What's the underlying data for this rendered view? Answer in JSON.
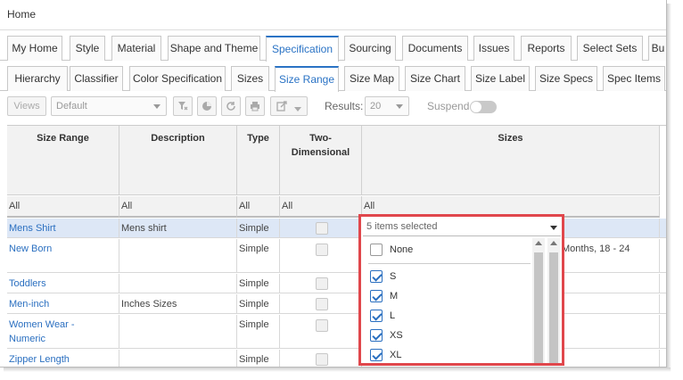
{
  "home": "Home",
  "tabs_main": [
    "My Home",
    "Style",
    "Material",
    "Shape and Theme",
    "Specification",
    "Sourcing",
    "Documents",
    "Issues",
    "Reports",
    "Select Sets",
    "Bu"
  ],
  "tabs_sub": [
    "Hierarchy",
    "Classifier",
    "Color Specification",
    "Sizes",
    "Size Range",
    "Size Map",
    "Size Chart",
    "Size Label",
    "Size Specs",
    "Spec Items"
  ],
  "active_main": "Specification",
  "active_sub": "Size Range",
  "toolbar": {
    "views": "Views",
    "view_select": "Default",
    "results_label": "Results:",
    "results_value": "20",
    "suspend_label": "Suspend"
  },
  "grid": {
    "headers": [
      "Size Range",
      "Description",
      "Type",
      "Two-\nDimensional",
      "Sizes"
    ],
    "filters": [
      "All",
      "All",
      "All",
      "All",
      "All"
    ],
    "rows": [
      {
        "name": "Mens Shirt",
        "desc": "Mens shirt",
        "type": "Simple",
        "sizes": ""
      },
      {
        "name": "New Born",
        "desc": "",
        "type": "Simple",
        "sizes": "Months, 18 - 24"
      },
      {
        "name": "Toddlers",
        "desc": "",
        "type": "Simple",
        "sizes": ""
      },
      {
        "name": "Men-inch",
        "desc": "Inches Sizes",
        "type": "Simple",
        "sizes": ""
      },
      {
        "name": "Women Wear -\nNumeric",
        "desc": "",
        "type": "Simple",
        "sizes": ""
      },
      {
        "name": "Zipper Length",
        "desc": "",
        "type": "Simple",
        "sizes": ""
      }
    ]
  },
  "dropdown": {
    "summary": "5 items selected",
    "options": [
      {
        "label": "None",
        "checked": false
      },
      {
        "label": "S",
        "checked": true
      },
      {
        "label": "M",
        "checked": true
      },
      {
        "label": "L",
        "checked": true
      },
      {
        "label": "XS",
        "checked": true
      },
      {
        "label": "XL",
        "checked": true
      }
    ]
  },
  "colors": {
    "accent": "#2a73c5",
    "highlight": "#e0474c",
    "row_selected": "#dde7f6"
  }
}
